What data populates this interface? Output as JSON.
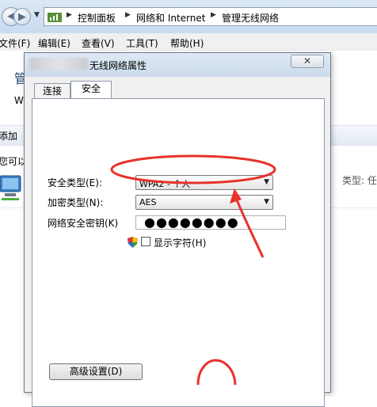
{
  "explorer": {
    "breadcrumb": [
      "控制面板",
      "网络和 Internet",
      "管理无线网络"
    ],
    "menu": [
      "文件(F)",
      "编辑(E)",
      "查看(V)",
      "工具(T)",
      "帮助(H)"
    ],
    "fragments": {
      "heading": "管",
      "subtext": "W",
      "add": "添加",
      "hint": "您可以",
      "type_label": "类型: 任"
    }
  },
  "dialog": {
    "title": "无线网络属性",
    "close_label": "✕",
    "tabs": [
      {
        "label": "连接",
        "active": false
      },
      {
        "label": "安全",
        "active": true
      }
    ],
    "fields": {
      "security_type": {
        "label": "安全类型(E):",
        "value": "WPA2 - 个人"
      },
      "encryption_type": {
        "label": "加密类型(N):",
        "value": "AES"
      },
      "network_key": {
        "label": "网络安全密钥(K)",
        "value": "●●●●●●●●"
      }
    },
    "show_chars_label": "显示字符(H)",
    "show_chars_checked": false,
    "advanced_button": "高级设置(D)"
  },
  "icons": [
    "back-icon",
    "forward-icon",
    "network-folder-icon",
    "uac-shield-icon",
    "wireless-network-icon"
  ],
  "colors": {
    "annotation_red": "#e8322b",
    "title_bar": "#cbdaeb",
    "dialog_bg": "#f0f0f0"
  }
}
